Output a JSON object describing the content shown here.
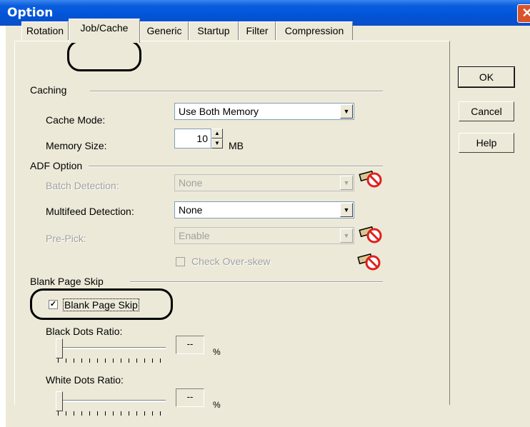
{
  "window": {
    "title": "Option",
    "close_label": "✕"
  },
  "tabs": [
    {
      "label": "Rotation"
    },
    {
      "label": "Job/Cache"
    },
    {
      "label": "Generic"
    },
    {
      "label": "Startup"
    },
    {
      "label": "Filter"
    },
    {
      "label": "Compression"
    }
  ],
  "caching": {
    "header": "Caching",
    "cache_mode_label": "Cache Mode:",
    "cache_mode_value": "Use Both Memory",
    "memory_size_label": "Memory Size:",
    "memory_size_value": "10",
    "memory_unit": "MB"
  },
  "adf": {
    "header": "ADF Option",
    "batch_label": "Batch Detection:",
    "batch_value": "None",
    "multifeed_label": "Multifeed Detection:",
    "multifeed_value": "None",
    "prepick_label": "Pre-Pick:",
    "prepick_value": "Enable",
    "overskew_label": "Check Over-skew",
    "overskew_checked": false
  },
  "blank_page": {
    "header": "Blank Page Skip",
    "checkbox_label": "Blank Page Skip",
    "checked": true,
    "black_label": "Black Dots Ratio:",
    "black_value": "--",
    "white_label": "White Dots Ratio:",
    "white_value": "--",
    "unit": "%"
  },
  "buttons": {
    "ok": "OK",
    "cancel": "Cancel",
    "help": "Help"
  },
  "colors": {
    "titlebar": "#0254d6",
    "face": "#ece9d8",
    "disabled_text": "#a0a0a0",
    "no_sign": "#e0201c"
  }
}
